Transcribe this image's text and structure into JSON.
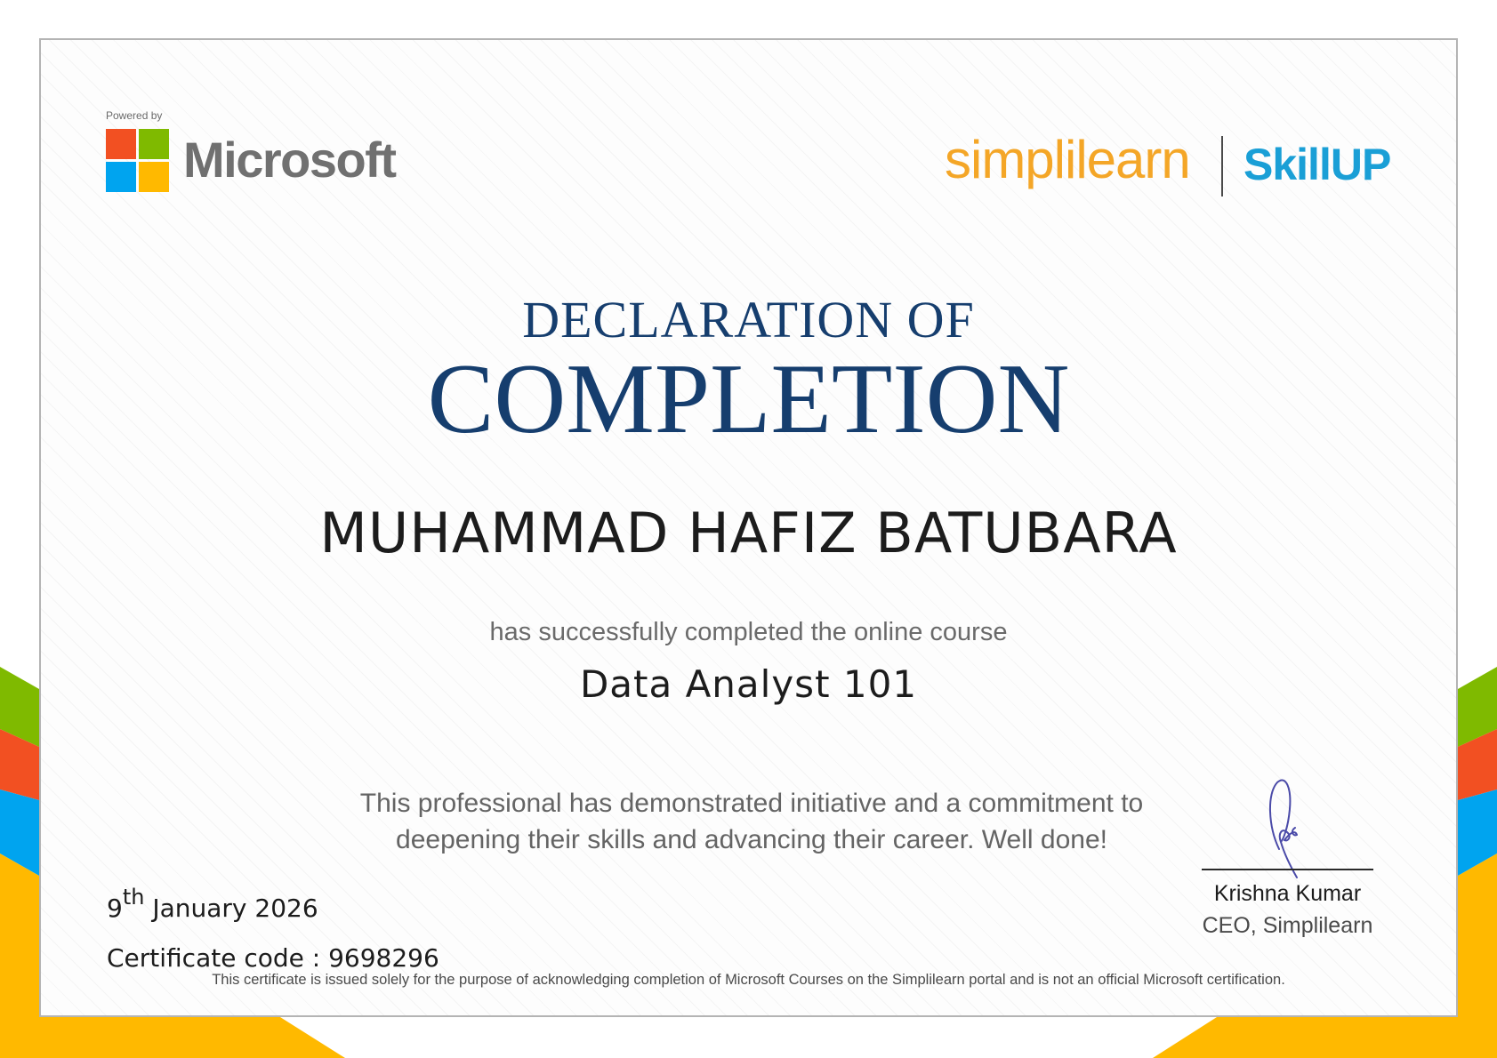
{
  "brand": {
    "powered_by": "Powered by",
    "microsoft": "Microsoft",
    "simplilearn": "simplilearn",
    "skillup": "SkillUP"
  },
  "certificate": {
    "heading_line1": "DECLARATION OF",
    "heading_line2": "COMPLETION",
    "recipient_name": "MUHAMMAD HAFIZ BATUBARA",
    "completed_text": "has successfully completed the online course",
    "course_name": "Data Analyst 101",
    "commendation_line1": "This professional has demonstrated initiative and a commitment to",
    "commendation_line2": "deepening their skills and advancing their career. Well done!",
    "date_day": "9",
    "date_suffix": "th",
    "date_month_year": " January 2026",
    "certificate_code": "Certificate code : 9698296",
    "disclaimer": "This certificate is issued solely for the purpose of acknowledging completion of Microsoft Courses on the Simplilearn portal and is not an official Microsoft certification."
  },
  "signatory": {
    "name": "Krishna Kumar",
    "title": "CEO, Simplilearn"
  },
  "colors": {
    "heading": "#163e6e",
    "ms_red": "#f25022",
    "ms_green": "#7fba00",
    "ms_blue": "#00a4ef",
    "ms_yellow": "#ffb900",
    "simplilearn_orange": "#f4a627",
    "skillup_blue": "#1a9fd6",
    "signature_ink": "#4a4aa8"
  }
}
